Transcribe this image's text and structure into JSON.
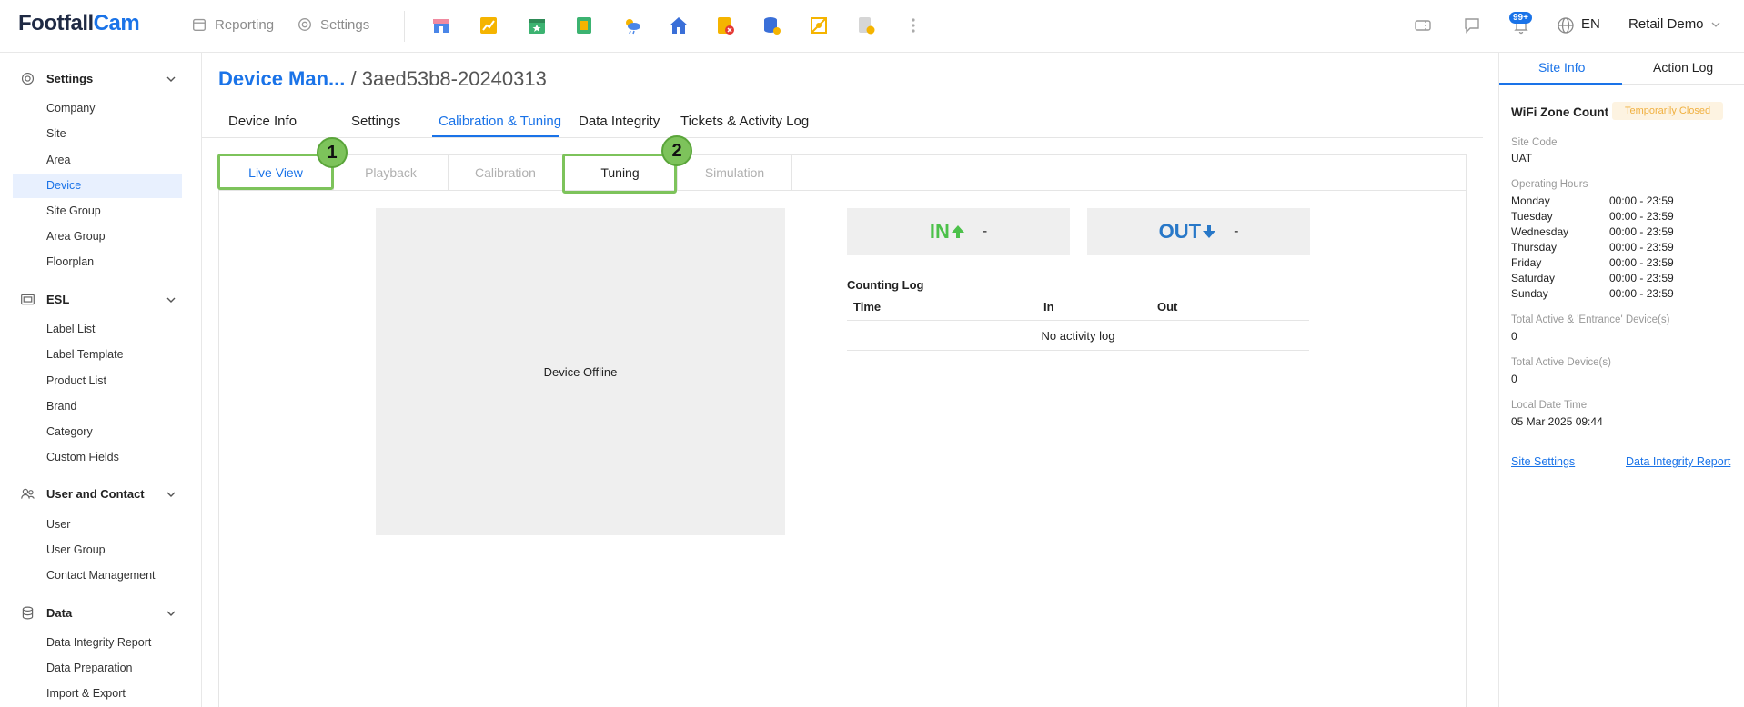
{
  "brand": {
    "name_part1": "Footfall",
    "name_part2": "Cam",
    "accent": "#1a73e8"
  },
  "topnav": {
    "reporting": "Reporting",
    "settings": "Settings"
  },
  "app_icons": [
    "store-icon",
    "chart-icon",
    "calendar-icon",
    "report-icon",
    "weather-icon",
    "home-icon",
    "alert-doc-icon",
    "database-icon",
    "network-icon",
    "export-doc-icon",
    "more-icon"
  ],
  "header_right": {
    "notifications_badge": "99+",
    "language": "EN",
    "account": "Retail Demo"
  },
  "sidebar": {
    "sections": [
      {
        "title": "Settings",
        "items": [
          "Company",
          "Site",
          "Area",
          "Device",
          "Site Group",
          "Area Group",
          "Floorplan"
        ]
      },
      {
        "title": "ESL",
        "items": [
          "Label List",
          "Label Template",
          "Product List",
          "Brand",
          "Category",
          "Custom Fields"
        ]
      },
      {
        "title": "User and Contact",
        "items": [
          "User",
          "User Group",
          "Contact Management"
        ]
      },
      {
        "title": "Data",
        "items": [
          "Data Integrity Report",
          "Data Preparation",
          "Import & Export"
        ]
      }
    ],
    "active_item": "Device"
  },
  "breadcrumb": {
    "parent": "Device Man...",
    "separator": "/",
    "current": "3aed53b8-20240313"
  },
  "main_tabs": [
    "Device Info",
    "Settings",
    "Calibration & Tuning",
    "Data Integrity",
    "Tickets & Activity Log"
  ],
  "active_main_tab": "Calibration & Tuning",
  "sub_tabs": [
    "Live View",
    "Playback",
    "Calibration",
    "Tuning",
    "Simulation"
  ],
  "active_sub_tab": "Live View",
  "markers": [
    "1",
    "2"
  ],
  "video": {
    "status": "Device Offline"
  },
  "counts": {
    "in_label": "IN",
    "in_value": "-",
    "out_label": "OUT",
    "out_value": "-",
    "in_color": "#4cc14a",
    "out_color": "#2878c8"
  },
  "counting_log": {
    "title": "Counting Log",
    "columns": [
      "Time",
      "In",
      "Out"
    ],
    "empty": "No activity log"
  },
  "right_panel": {
    "tabs": [
      "Site Info",
      "Action Log"
    ],
    "title": "WiFi Zone Count",
    "status": "Temporarily Closed",
    "site_code_label": "Site Code",
    "site_code": "UAT",
    "hours_label": "Operating Hours",
    "hours": [
      {
        "day": "Monday",
        "time": "00:00 - 23:59"
      },
      {
        "day": "Tuesday",
        "time": "00:00 - 23:59"
      },
      {
        "day": "Wednesday",
        "time": "00:00 - 23:59"
      },
      {
        "day": "Thursday",
        "time": "00:00 - 23:59"
      },
      {
        "day": "Friday",
        "time": "00:00 - 23:59"
      },
      {
        "day": "Saturday",
        "time": "00:00 - 23:59"
      },
      {
        "day": "Sunday",
        "time": "00:00 - 23:59"
      }
    ],
    "entrance_label": "Total Active & 'Entrance' Device(s)",
    "entrance_value": "0",
    "active_label": "Total Active Device(s)",
    "active_value": "0",
    "datetime_label": "Local Date Time",
    "datetime_value": "05 Mar 2025 09:44",
    "link_site_settings": "Site Settings",
    "link_integrity": "Data Integrity Report"
  }
}
